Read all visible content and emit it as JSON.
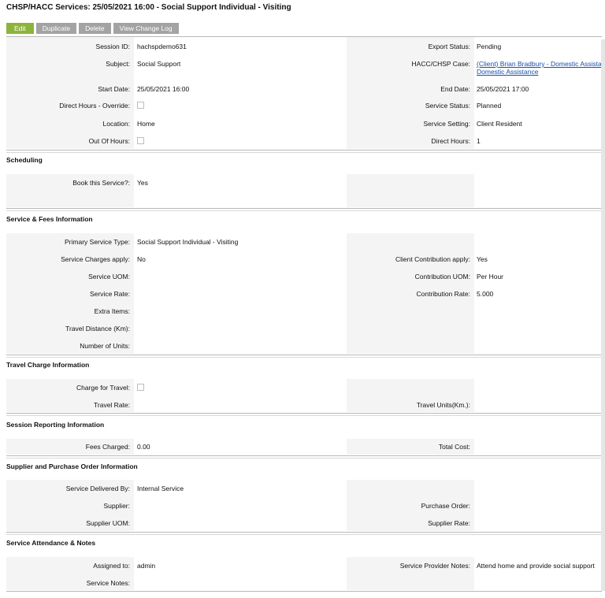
{
  "page": {
    "title": "CHSP/HACC Services: 25/05/2021 16:00 - Social Support Individual - Visiting"
  },
  "toolbar": {
    "edit": "Edit",
    "duplicate": "Duplicate",
    "delete": "Delete",
    "view_change_log": "View Change Log"
  },
  "details": {
    "session_id": {
      "label": "Session ID:",
      "value": "hachspdemo631"
    },
    "subject": {
      "label": "Subject:",
      "value": "Social Support"
    },
    "start_date": {
      "label": "Start Date:",
      "value": "25/05/2021 16:00"
    },
    "direct_hours_override": {
      "label": "Direct Hours - Override:"
    },
    "location": {
      "label": "Location:",
      "value": "Home"
    },
    "out_of_hours": {
      "label": "Out Of Hours:"
    },
    "export_status": {
      "label": "Export Status:",
      "value": "Pending"
    },
    "case": {
      "label": "HACC/CHSP Case:",
      "value_line1": "(Client) Brian Bradbury - Domestic Assista",
      "value_line2": "Domestic Assistance"
    },
    "end_date": {
      "label": "End Date:",
      "value": "25/05/2021 17:00"
    },
    "service_status": {
      "label": "Service Status:",
      "value": "Planned"
    },
    "service_setting": {
      "label": "Service Setting:",
      "value": "Client Resident"
    },
    "direct_hours": {
      "label": "Direct Hours:",
      "value": "1"
    }
  },
  "scheduling": {
    "heading": "Scheduling",
    "book": {
      "label": "Book this Service?:",
      "value": "Yes"
    }
  },
  "service_fees": {
    "heading": "Service & Fees Information",
    "primary_type": {
      "label": "Primary Service Type:",
      "value": "Social Support Individual - Visiting"
    },
    "charges_apply": {
      "label": "Service Charges apply:",
      "value": "No"
    },
    "client_contribution": {
      "label": "Client Contribution apply:",
      "value": "Yes"
    },
    "service_uom": {
      "label": "Service UOM:"
    },
    "contribution_uom": {
      "label": "Contribution UOM:",
      "value": "Per Hour"
    },
    "service_rate": {
      "label": "Service Rate:"
    },
    "contribution_rate": {
      "label": "Contribution Rate:",
      "value": "5.000"
    },
    "extra_items": {
      "label": "Extra Items:"
    },
    "travel_distance": {
      "label": "Travel Distance (Km):"
    },
    "number_of_units": {
      "label": "Number of Units:"
    }
  },
  "travel": {
    "heading": "Travel Charge Information",
    "charge_for_travel": {
      "label": "Charge for Travel:"
    },
    "travel_rate": {
      "label": "Travel Rate:"
    },
    "travel_units": {
      "label": "Travel Units(Km.):"
    }
  },
  "session_reporting": {
    "heading": "Session Reporting Information",
    "fees_charged": {
      "label": "Fees Charged:",
      "value": "0.00"
    },
    "total_cost": {
      "label": "Total Cost:"
    }
  },
  "supplier": {
    "heading": "Supplier and Purchase Order Information",
    "delivered_by": {
      "label": "Service Delivered By:",
      "value": "Internal Service"
    },
    "supplier": {
      "label": "Supplier:"
    },
    "purchase_order": {
      "label": "Purchase Order:"
    },
    "supplier_uom": {
      "label": "Supplier UOM:"
    },
    "supplier_rate": {
      "label": "Supplier Rate:"
    }
  },
  "attendance": {
    "heading": "Service Attendance & Notes",
    "assigned_to": {
      "label": "Assigned to:",
      "value": "admin"
    },
    "provider_notes": {
      "label": "Service Provider Notes:",
      "value": "Attend home and provide social support"
    },
    "service_notes": {
      "label": "Service Notes:"
    }
  }
}
